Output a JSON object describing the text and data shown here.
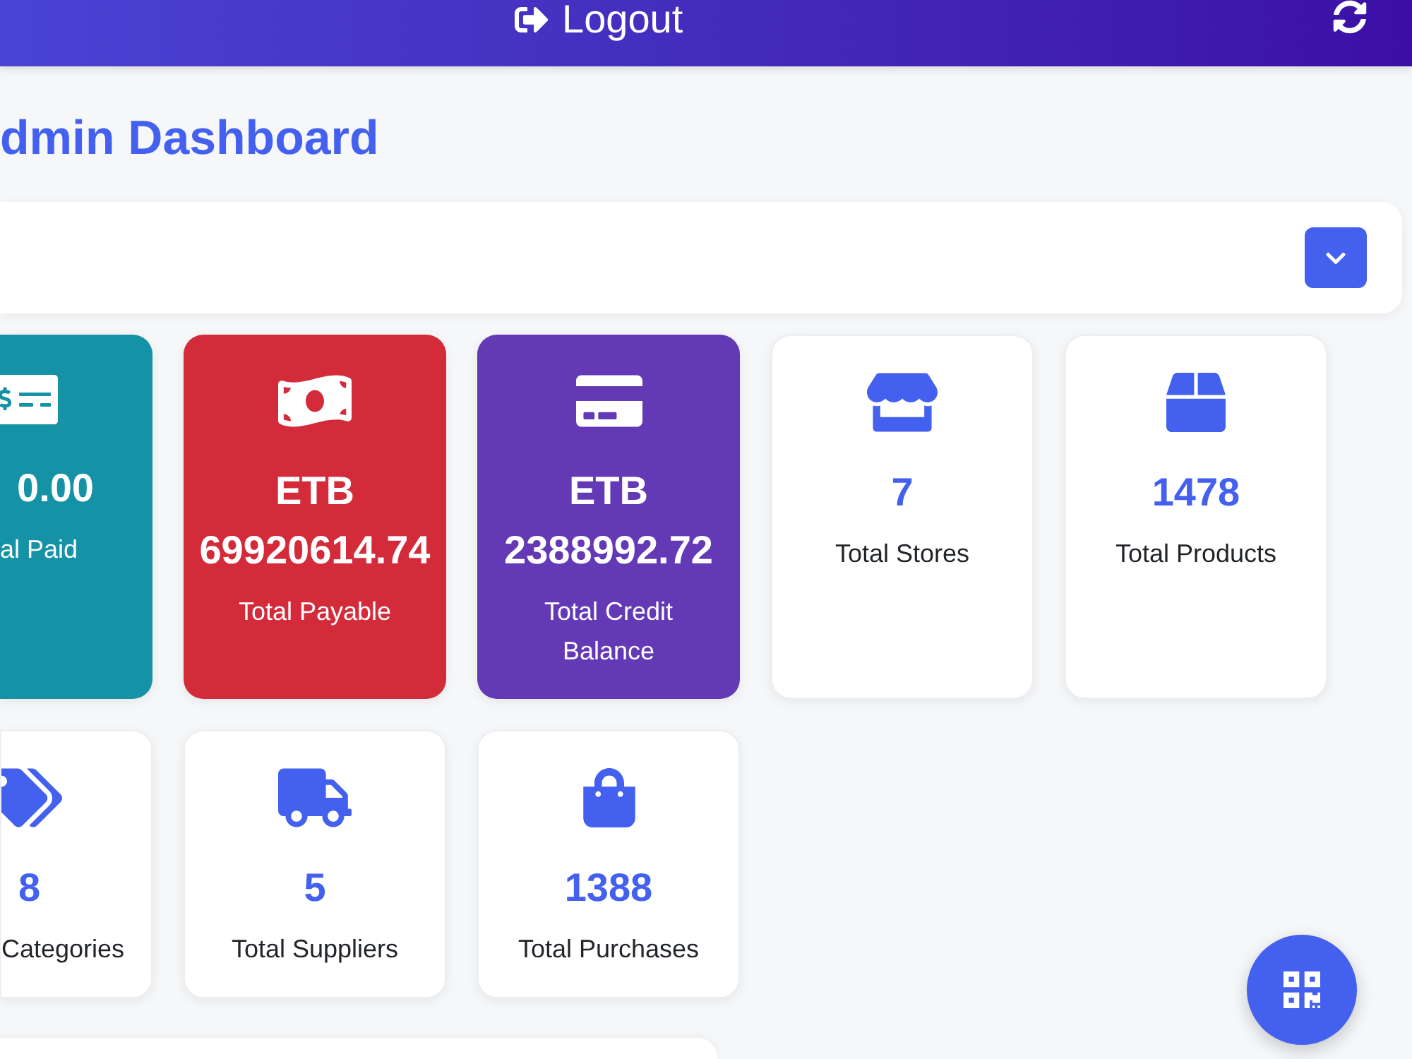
{
  "header": {
    "logout_button": {
      "label": "Logout"
    }
  },
  "page": {
    "title": "dmin Dashboard"
  },
  "stat_rows": [
    {
      "cards": [
        {
          "kind": "colored",
          "color": "#1592a5",
          "value": "0.00",
          "label": "al Paid"
        },
        {
          "kind": "colored",
          "color": "#d42b3b",
          "value": "ETB 69920614.74",
          "label": "Total Payable"
        },
        {
          "kind": "colored",
          "color": "#6439b5",
          "value": "ETB 2388992.72",
          "label": "Total Credit Balance"
        },
        {
          "kind": "plain",
          "value": "7",
          "label": "Total Stores"
        },
        {
          "kind": "plain",
          "value": "1478",
          "label": "Total Products"
        }
      ]
    },
    {
      "cards": [
        {
          "kind": "plain",
          "value": "8",
          "label": "Categories"
        },
        {
          "kind": "plain",
          "value": "5",
          "label": "Total Suppliers"
        },
        {
          "kind": "plain",
          "value": "1388",
          "label": "Total Purchases"
        }
      ]
    }
  ]
}
